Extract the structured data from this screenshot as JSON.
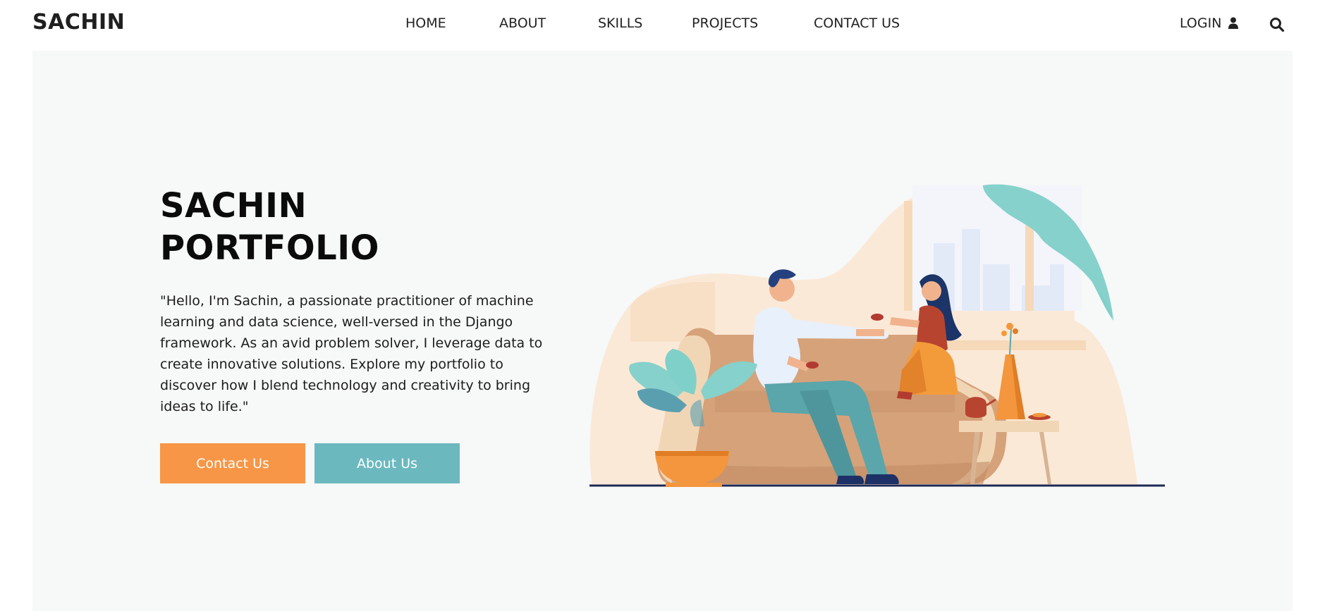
{
  "header": {
    "brand": "SACHIN",
    "nav": [
      "HOME",
      "ABOUT",
      "SKILLS",
      "PROJECTS",
      "CONTACT US"
    ],
    "login_label": "LOGIN",
    "icons": {
      "login": "user-icon",
      "search": "search-icon"
    }
  },
  "hero": {
    "title_line1": "SACHIN",
    "title_line2": "PORTFOLIO",
    "description": "\"Hello, I'm Sachin, a passionate practitioner of machine learning and data science, well-versed in the Django framework. As an avid problem solver, I leverage data to create innovative solutions. Explore my portfolio to discover how I blend technology and creativity to bring ideas to life.\"",
    "contact_button": "Contact Us",
    "about_button": "About Us",
    "illustration": "couple-on-sofa-illustration"
  },
  "colors": {
    "accent_orange": "#f79646",
    "accent_teal": "#6cb8bf",
    "hero_background": "#f7f8f8"
  }
}
